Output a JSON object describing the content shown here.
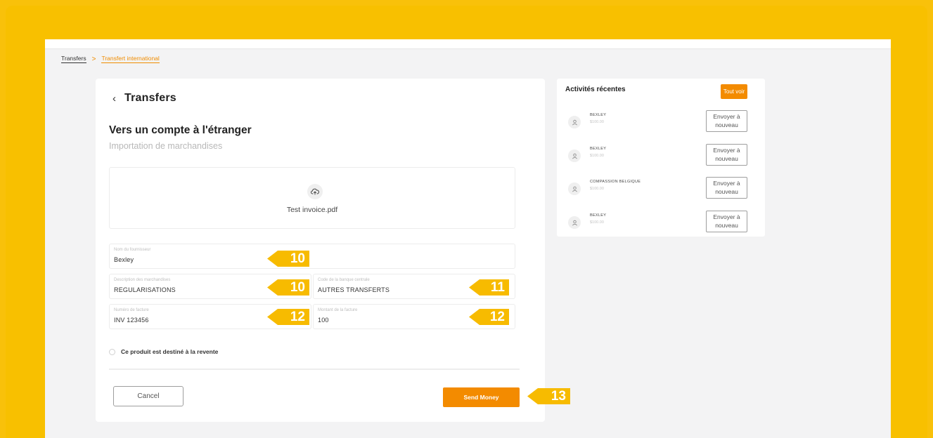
{
  "breadcrumb": {
    "root": "Transfers",
    "separator": ">",
    "current": "Transfert international"
  },
  "form": {
    "back_icon": "chevron-left-icon",
    "title": "Transfers",
    "heading": "Vers un compte à l'étranger",
    "subheading": "Importation de marchandises",
    "upload": {
      "icon": "cloud-upload-icon",
      "file_name": "Test invoice.pdf"
    },
    "fields": {
      "supplier": {
        "label": "Nom du fournisseur",
        "value": "Bexley"
      },
      "goods_description": {
        "label": "Description des marchandises",
        "value": "REGULARISATIONS"
      },
      "bank_code": {
        "label": "Code de la banque centrale",
        "value": "AUTRES TRANSFERTS"
      },
      "invoice_number": {
        "label": "Numéro de facture",
        "value": "INV 123456"
      },
      "invoice_amount": {
        "label": "Montant de la facture",
        "value": "100"
      }
    },
    "resale_checkbox": {
      "label": "Ce produit est destiné à la revente",
      "checked": false
    },
    "cancel_label": "Cancel",
    "send_label": "Send Money"
  },
  "annotations": {
    "supplier": "10",
    "goods_description": "10",
    "bank_code": "11",
    "invoice_number": "12",
    "invoice_amount": "12",
    "send": "13",
    "color": "#F7BB00"
  },
  "recent": {
    "title": "Activités récentes",
    "see_all_label": "Tout voir",
    "items": [
      {
        "name": "BEXLEY",
        "amount": "$100.00",
        "resend_label": "Envoyer à nouveau"
      },
      {
        "name": "BEXLEY",
        "amount": "$100.00",
        "resend_label": "Envoyer à nouveau"
      },
      {
        "name": "COMPASSION BELGIQUE",
        "amount": "$100.00",
        "resend_label": "Envoyer à nouveau"
      },
      {
        "name": "BEXLEY",
        "amount": "$100.00",
        "resend_label": "Envoyer à nouveau"
      }
    ]
  },
  "colors": {
    "accent": "#F38B00",
    "background": "#F9C10A",
    "breadcrumb_active": "#F08C00"
  }
}
